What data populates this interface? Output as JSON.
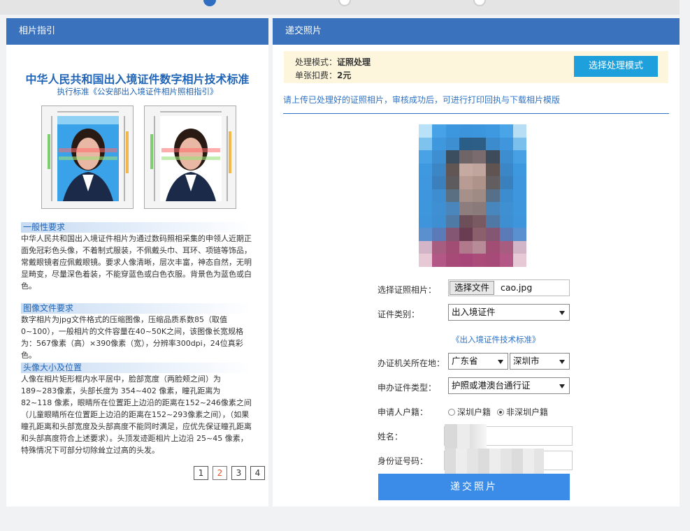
{
  "steps": [
    "step-1",
    "step-2",
    "step-3"
  ],
  "left_panel": {
    "title": "相片指引",
    "standard_title": "中华人民共和国出入境证件数字相片技术标准",
    "standard_subtitle": "执行标准《公安部出入境证件相片照相指引》",
    "sections": [
      {
        "heading": "一般性要求",
        "text": "中华人民共和国出入境证件相片为通过数码照相采集的申领人近期正面免冠彩色头像，不着制式服装，不佩戴头巾、耳环、项链等饰品，常戴眼镜者应佩戴眼镜。要求人像清晰，层次丰富，神态自然，无明显畸变，尽量深色着装，不能穿蓝色或白色衣服。背景色为蓝色或白色。"
      },
      {
        "heading": "图像文件要求",
        "text": "数字相片为jpg文件格式的压缩图像，压缩品质系数85（取值0~100），一般相片的文件容量在40~50K之间，该图像长宽规格为：567像素（高）×390像素（宽），分辨率300dpi，24位真彩色。"
      },
      {
        "heading": "头像大小及位置",
        "text": "人像在相片矩形框内水平居中，脸部宽度（两脸颊之间）为 189~283像素，头部长度为 354~402 像素，瞳孔距离为 82~118 像素，眼睛所在位置距上边沿的距离在152~246像素之间（儿童眼睛所在位置距上边沿的距离在152~293像素之间），（如果瞳孔距离和头部宽度及头部高度不能同时满足，应优先保证瞳孔距离和头部高度符合上述要求）。头顶发迹距相片上边沿 25~45 像素，特殊情况下可部分切除耸立过高的头发。"
      }
    ],
    "pagination": [
      "1",
      "2",
      "3",
      "4"
    ],
    "current_page": "2"
  },
  "right_panel": {
    "title": "递交照片",
    "mode_label": "处理模式：",
    "mode_value": "证照处理",
    "fee_label": "单张扣费：",
    "fee_value": "2元",
    "mode_button": "选择处理模式",
    "hint": "请上传已处理好的证照相片，审核成功后，可进行打印回执与下载相片模版",
    "form": {
      "photo_label": "选择证照相片：",
      "file_button": "选择文件",
      "file_name": "cao.jpg",
      "doc_type_label": "证件类别：",
      "doc_type_value": "出入境证件",
      "standard_link": "《出入境证件技术标准》",
      "office_label": "办证机关所在地：",
      "province_value": "广东省",
      "city_value": "深圳市",
      "apply_type_label": "申办证件类型：",
      "apply_type_value": "护照或港澳台通行证",
      "hukou_label": "申请人户籍：",
      "hukou_options": [
        "深圳户籍",
        "非深圳户籍"
      ],
      "hukou_selected": "非深圳户籍",
      "name_label": "姓名：",
      "id_label": "身份证号码：",
      "submit_label": "递交照片"
    },
    "colors": {
      "header": "#3a72be",
      "mode_button": "#1ea0dc",
      "submit": "#3a8ce8",
      "link": "#2f74c7"
    }
  }
}
